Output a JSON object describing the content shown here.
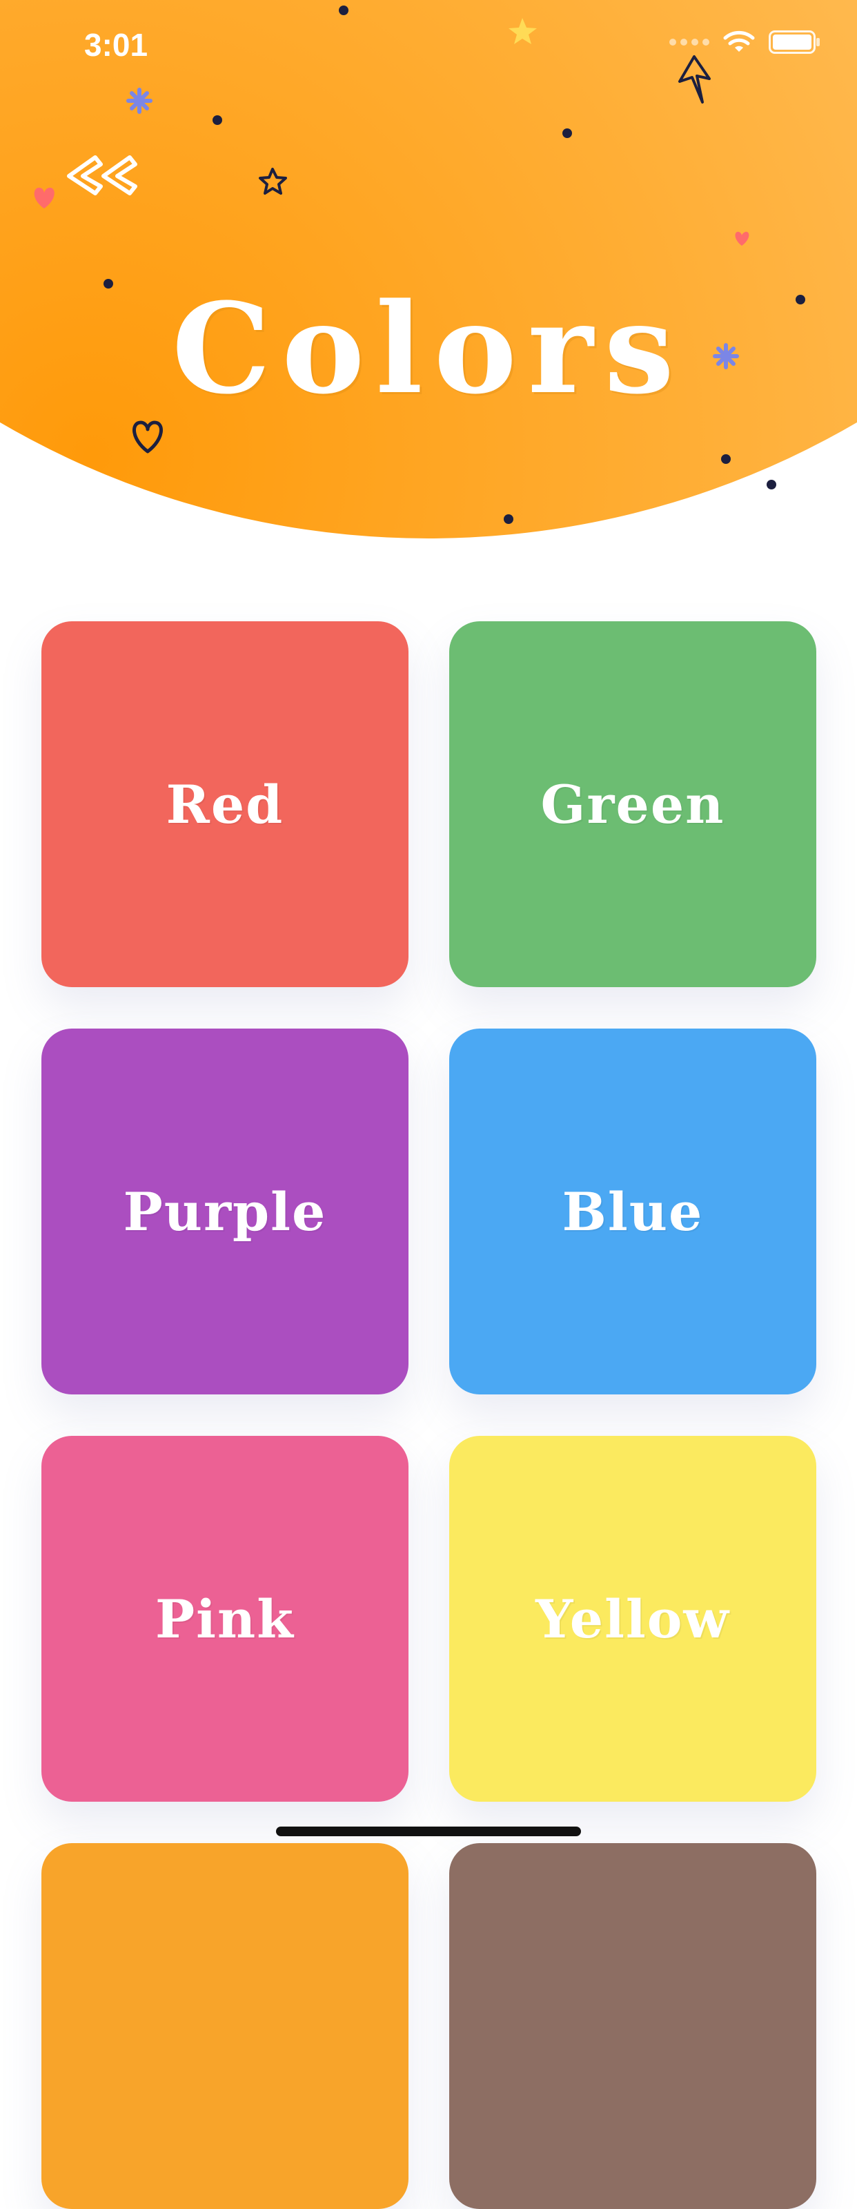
{
  "status_bar": {
    "time": "3:01"
  },
  "header": {
    "title": "Colors",
    "gradient_from": "#ff9a0a",
    "gradient_to": "#ffd07c",
    "back_icon": "double-chevron-left-icon"
  },
  "tiles": [
    {
      "label": "Red",
      "color": "#f2665c"
    },
    {
      "label": "Green",
      "color": "#6cbd72"
    },
    {
      "label": "Purple",
      "color": "#ab4ec0"
    },
    {
      "label": "Blue",
      "color": "#4ba8f3"
    },
    {
      "label": "Pink",
      "color": "#ec6194"
    },
    {
      "label": "Yellow",
      "color": "#fbea5f"
    },
    {
      "label": "",
      "color": "#f8a42a"
    },
    {
      "label": "",
      "color": "#8d6e63"
    }
  ]
}
